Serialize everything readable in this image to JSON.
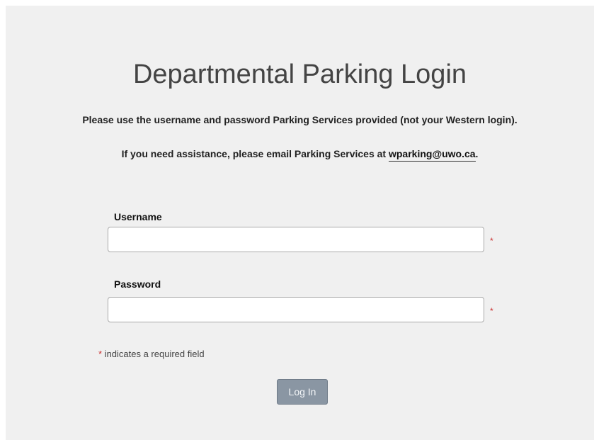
{
  "page": {
    "title": "Departmental Parking Login",
    "instructions": "Please use the username and password Parking Services provided (not your Western login).",
    "assist_prefix": "If you need assistance, please email Parking Services at ",
    "assist_email": "wparking@uwo.ca",
    "assist_suffix": "."
  },
  "form": {
    "username_label": "Username",
    "username_value": "",
    "password_label": "Password",
    "password_value": "",
    "required_marker": "*",
    "required_note": " indicates a required field",
    "login_label": "Log In"
  },
  "colors": {
    "panel_background": "#f0f0f0",
    "required_marker": "#cc3333",
    "button_background": "#8a96a3"
  }
}
